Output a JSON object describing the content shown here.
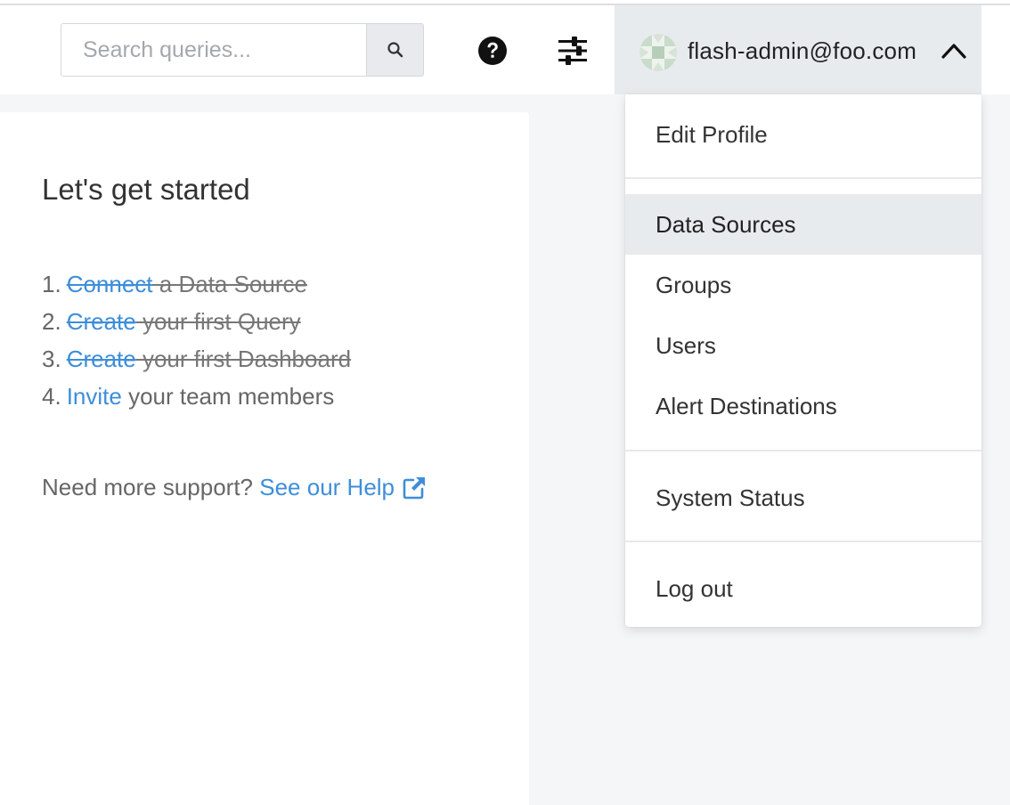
{
  "header": {
    "search": {
      "placeholder": "Search queries...",
      "value": ""
    },
    "search_button_icon": "search-icon",
    "help_icon": "help-circle-icon",
    "settings_icon": "sliders-icon",
    "user": {
      "email": "flash-admin@foo.com",
      "menu_state_icon": "chevron-up-icon"
    }
  },
  "user_dropdown": {
    "items": [
      {
        "label": "Edit Profile"
      },
      {
        "label": "Data Sources",
        "active": true
      },
      {
        "label": "Groups"
      },
      {
        "label": "Users"
      },
      {
        "label": "Alert Destinations"
      },
      {
        "label": "System Status"
      },
      {
        "label": "Log out"
      }
    ]
  },
  "getting_started": {
    "title": "Let's get started",
    "steps": [
      {
        "num": "1.",
        "link": "Connect",
        "text": " a Data Source",
        "done": true
      },
      {
        "num": "2.",
        "link": "Create",
        "text": " your first Query",
        "done": true
      },
      {
        "num": "3.",
        "link": "Create",
        "text": " your first Dashboard",
        "done": true
      },
      {
        "num": "4.",
        "link": "Invite",
        "text": " your team members",
        "done": false
      }
    ],
    "support_text": "Need more support? ",
    "support_link": "See our Help",
    "support_link_icon": "external-link-icon"
  },
  "colors": {
    "link": "#3e8ed9",
    "menu_highlight": "#e8ebee",
    "page_background": "#f5f6f8"
  }
}
